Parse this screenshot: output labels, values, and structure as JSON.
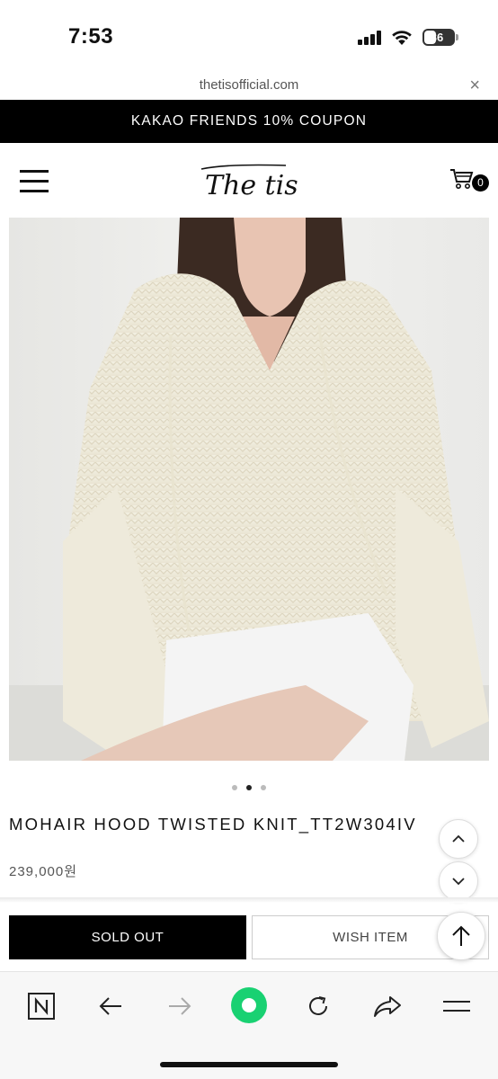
{
  "status_bar": {
    "time": "7:53",
    "battery": "36"
  },
  "url_bar": {
    "url": "thetisofficial.com",
    "close": "×"
  },
  "promo": {
    "text": "KAKAO FRIENDS 10% COUPON"
  },
  "header": {
    "logo": "The tis",
    "cart_count": "0"
  },
  "carousel": {
    "count": 3,
    "active_index": 1
  },
  "product": {
    "title": "MOHAIR HOOD TWISTED KNIT_TT2W304IV",
    "price": "239,000원"
  },
  "actions": {
    "sold_out": "SOLD OUT",
    "wish": "WISH ITEM"
  },
  "toolbar": {
    "icons": [
      "naver-n-icon",
      "back-icon",
      "forward-icon",
      "green-dot-icon",
      "refresh-icon",
      "share-icon",
      "menu-icon"
    ]
  },
  "colors": {
    "promo_bg": "#000000",
    "green_button": "#19D172",
    "sold_out_bg": "#000000"
  }
}
